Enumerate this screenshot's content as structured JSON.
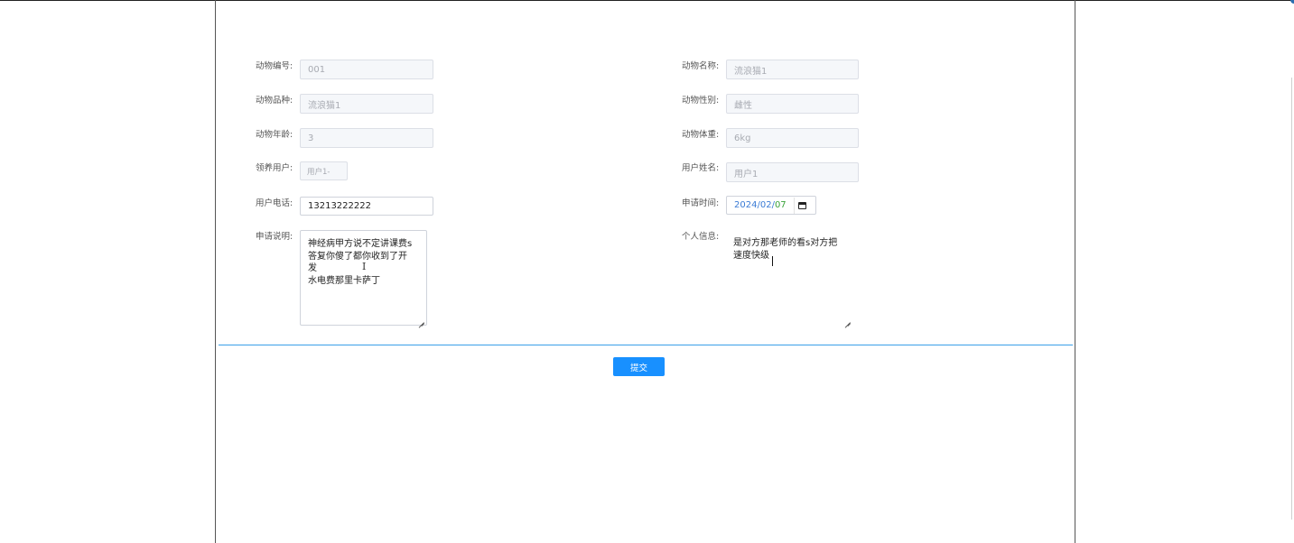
{
  "form": {
    "animal_id": {
      "label": "动物编号:",
      "value": "001"
    },
    "animal_name": {
      "label": "动物名称:",
      "value": "流浪猫1"
    },
    "animal_breed": {
      "label": "动物品种:",
      "value": "流浪猫1"
    },
    "animal_gender": {
      "label": "动物性别:",
      "value": "雌性"
    },
    "animal_age": {
      "label": "动物年龄:",
      "value": "3"
    },
    "animal_weight": {
      "label": "动物体重:",
      "value": "6kg"
    },
    "adopt_user": {
      "label": "领养用户:",
      "value": "用户1-"
    },
    "user_realname": {
      "label": "用户姓名:",
      "value": "用户1"
    },
    "user_phone": {
      "label": "用户电话:",
      "value": "13213222222"
    },
    "apply_time": {
      "label": "申请时间:",
      "year": "2024",
      "sep1": "/",
      "month": "02",
      "sep2": "/",
      "day": "07"
    },
    "apply_desc": {
      "label": "申请说明:",
      "value": "神经病甲方说不定讲课费s\n答复你傻了都你收到了开\n发\n水电费那里卡萨丁"
    },
    "personal_info": {
      "label": "个人信息:",
      "value": "是对方那老师的看s对方把\n速度快级"
    }
  },
  "actions": {
    "submit_label": "提交"
  },
  "icons": {
    "calendar": "calendar-icon",
    "cursor": "text-cursor-icon",
    "resize": "resize-grip-icon"
  },
  "colors": {
    "primary": "#1890ff",
    "divider": "#3aa0e8"
  }
}
